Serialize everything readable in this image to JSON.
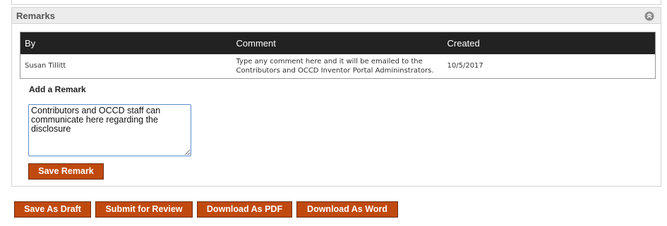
{
  "remarks": {
    "title": "Remarks",
    "collapse_icon": "chevron-up-circle-icon",
    "table": {
      "headers": {
        "by": "By",
        "comment": "Comment",
        "created": "Created"
      },
      "rows": [
        {
          "by": "Susan Tillitt",
          "comment": "Type any comment here and it will be emailed to the Contributors and OCCD Inventor Portal Admininstrators.",
          "created": "10/5/2017"
        }
      ]
    },
    "add_label": "Add a Remark",
    "textarea_value": "Contributors and OCCD staff can communicate here regarding the disclosure",
    "save_label": "Save Remark"
  },
  "actions": {
    "save_draft": "Save As Draft",
    "submit_review": "Submit for Review",
    "download_pdf": "Download As PDF",
    "download_word": "Download As Word"
  },
  "colors": {
    "button_bg": "#c04a0e",
    "table_header_bg": "#222222",
    "panel_header_bg": "#ececec"
  }
}
